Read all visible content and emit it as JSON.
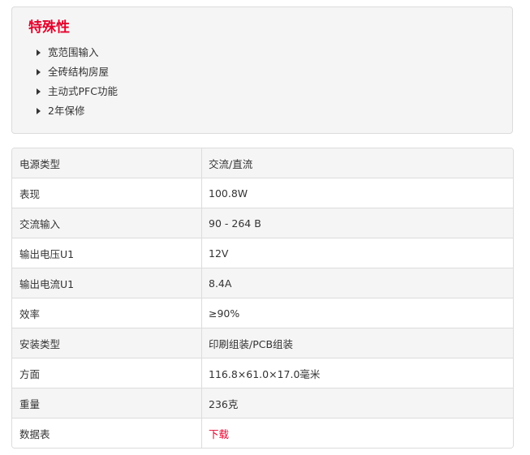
{
  "features": {
    "title": "特殊性",
    "items": [
      "宽范围输入",
      "全砖结构房屋",
      "主动式PFC功能",
      "2年保修"
    ]
  },
  "specs": [
    {
      "label": "电源类型",
      "value": "交流/直流",
      "link": false
    },
    {
      "label": "表现",
      "value": "100.8W",
      "link": false
    },
    {
      "label": "交流输入",
      "value": "90 - 264 В",
      "link": false
    },
    {
      "label": "输出电压U1",
      "value": "12V",
      "link": false
    },
    {
      "label": "输出电流U1",
      "value": "8.4A",
      "link": false
    },
    {
      "label": "效率",
      "value": "≥90%",
      "link": false
    },
    {
      "label": "安装类型",
      "value": "印刷组装/PCB组装",
      "link": false
    },
    {
      "label": "方面",
      "value": "116.8×61.0×17.0毫米",
      "link": false
    },
    {
      "label": "重量",
      "value": "236克",
      "link": false
    },
    {
      "label": "数据表",
      "value": "下载",
      "link": true
    }
  ],
  "colors": {
    "accent": "#e4002b",
    "panel_bg": "#f5f5f5",
    "border": "#dcdcdc",
    "text": "#333333"
  }
}
